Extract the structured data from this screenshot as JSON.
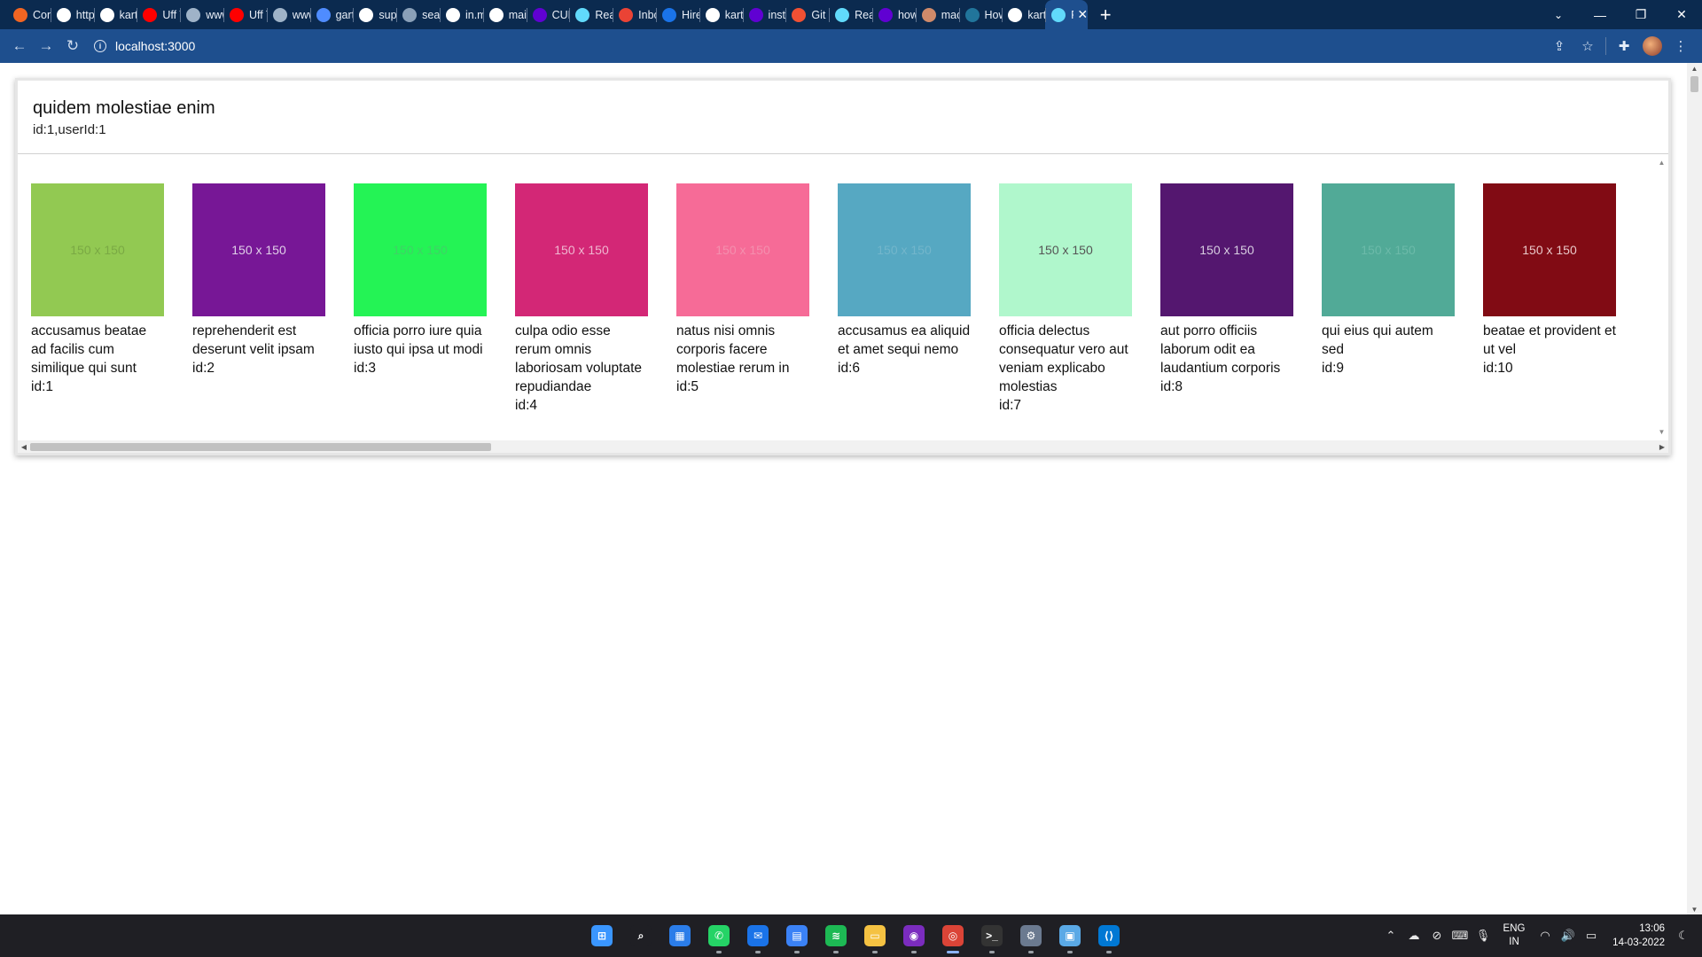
{
  "browser": {
    "tabs": [
      {
        "label": "Cons",
        "icon": "blogger-icon",
        "color": "#f26522"
      },
      {
        "label": "http:",
        "icon": "globe-icon",
        "color": "#ffffff"
      },
      {
        "label": "karti",
        "icon": "github-icon",
        "color": "#ffffff"
      },
      {
        "label": "Uff T",
        "icon": "youtube-icon",
        "color": "#ff0000"
      },
      {
        "label": "www.",
        "icon": "linkedin-icon",
        "color": "#9fb3c8"
      },
      {
        "label": "Uff T",
        "icon": "youtube-icon",
        "color": "#ff0000"
      },
      {
        "label": "www.",
        "icon": "linkedin-icon",
        "color": "#9fb3c8"
      },
      {
        "label": "gart",
        "icon": "headset-icon",
        "color": "#4f8cff"
      },
      {
        "label": "supp",
        "icon": "google-icon",
        "color": "#ffffff"
      },
      {
        "label": "sear",
        "icon": "check-icon",
        "color": "#8aa0b8"
      },
      {
        "label": "in.m",
        "icon": "medium-icon",
        "color": "#ffffff"
      },
      {
        "label": "mail.",
        "icon": "mail-m-icon",
        "color": "#ffffff"
      },
      {
        "label": "CUR:",
        "icon": "yahoo-icon",
        "color": "#6001d2"
      },
      {
        "label": "Reac",
        "icon": "react-icon",
        "color": "#61dafb"
      },
      {
        "label": "Inbo",
        "icon": "gmail-icon",
        "color": "#ea4335"
      },
      {
        "label": "Hire",
        "icon": "at-icon",
        "color": "#1a73e8"
      },
      {
        "label": "karti",
        "icon": "github-icon",
        "color": "#ffffff"
      },
      {
        "label": "insta",
        "icon": "yahoo-icon",
        "color": "#6001d2"
      },
      {
        "label": "Git -",
        "icon": "git-icon",
        "color": "#f05033"
      },
      {
        "label": "Reac",
        "icon": "react-icon",
        "color": "#61dafb"
      },
      {
        "label": "how",
        "icon": "yahoo-icon",
        "color": "#6001d2"
      },
      {
        "label": "mac",
        "icon": "apple-icon",
        "color": "#d08a6a"
      },
      {
        "label": "How",
        "icon": "wordpress-icon",
        "color": "#21759b"
      },
      {
        "label": "karti",
        "icon": "github-icon",
        "color": "#ffffff"
      },
      {
        "label": "R",
        "icon": "react-icon",
        "color": "#61dafb",
        "active": true
      }
    ],
    "url": "localhost:3000"
  },
  "post": {
    "title": "quidem molestiae enim",
    "meta": "id:1,userId:1"
  },
  "photos": [
    {
      "thumb_label": "150 x 150",
      "color": "#92c952",
      "text_color": "#7aa944",
      "title": "accusamus beatae ad facilis cum similique qui sunt",
      "id_label": "id:1"
    },
    {
      "thumb_label": "150 x 150",
      "color": "#771796",
      "text_color": "#e0cfe8",
      "title": "reprehenderit est deserunt velit ipsam",
      "id_label": "id:2"
    },
    {
      "thumb_label": "150 x 150",
      "color": "#24f355",
      "text_color": "#3fd266",
      "title": "officia porro iure quia iusto qui ipsa ut modi",
      "id_label": "id:3"
    },
    {
      "thumb_label": "150 x 150",
      "color": "#d32776",
      "text_color": "#efb7d0",
      "title": "culpa odio esse rerum omnis laboriosam voluptate repudiandae",
      "id_label": "id:4"
    },
    {
      "thumb_label": "150 x 150",
      "color": "#f66b97",
      "text_color": "#f48fae",
      "title": "natus nisi omnis corporis facere molestiae rerum in",
      "id_label": "id:5"
    },
    {
      "thumb_label": "150 x 150",
      "color": "#56a8c2",
      "text_color": "#73b6cb",
      "title": "accusamus ea aliquid et amet sequi nemo",
      "id_label": "id:6"
    },
    {
      "thumb_label": "150 x 150",
      "color": "#b0f7cc",
      "text_color": "#555555",
      "title": "officia delectus consequatur vero aut veniam explicabo molestias",
      "id_label": "id:7"
    },
    {
      "thumb_label": "150 x 150",
      "color": "#54176f",
      "text_color": "#d8cde0",
      "title": "aut porro officiis laborum odit ea laudantium corporis",
      "id_label": "id:8"
    },
    {
      "thumb_label": "150 x 150",
      "color": "#51aa97",
      "text_color": "#6cbaa9",
      "title": "qui eius qui autem sed",
      "id_label": "id:9"
    },
    {
      "thumb_label": "150 x 150",
      "color": "#810b14",
      "text_color": "#e8c7c9",
      "title": "beatae et provident et ut vel",
      "id_label": "id:10"
    }
  ],
  "taskbar": {
    "apps": [
      {
        "icon": "windows-start-icon",
        "color": "#3a96ff",
        "glyph": "⊞"
      },
      {
        "icon": "search-icon",
        "color": "#1f1f24",
        "glyph": "⌕"
      },
      {
        "icon": "widgets-icon",
        "color": "#2b7de9",
        "glyph": "▦"
      },
      {
        "icon": "whatsapp-icon",
        "color": "#25d366",
        "glyph": "✆"
      },
      {
        "icon": "mail-icon",
        "color": "#1a73e8",
        "glyph": "✉"
      },
      {
        "icon": "store-icon",
        "color": "#3b82f6",
        "glyph": "▤"
      },
      {
        "icon": "spotify-icon",
        "color": "#1db954",
        "glyph": "≋"
      },
      {
        "icon": "file-explorer-icon",
        "color": "#f5c242",
        "glyph": "▭"
      },
      {
        "icon": "podcast-icon",
        "color": "#7b2cbf",
        "glyph": "◉"
      },
      {
        "icon": "chrome-icon",
        "color": "#db4437",
        "glyph": "◎",
        "active": true
      },
      {
        "icon": "terminal-icon",
        "color": "#333333",
        "glyph": ">_"
      },
      {
        "icon": "settings-icon",
        "color": "#6b7a90",
        "glyph": "⚙"
      },
      {
        "icon": "remote-desktop-icon",
        "color": "#5aa9e6",
        "glyph": "▣"
      },
      {
        "icon": "vscode-icon",
        "color": "#0078d4",
        "glyph": "⟨⟩"
      }
    ],
    "lang": "ENG",
    "region": "IN",
    "time": "13:06",
    "date": "14-03-2022"
  }
}
